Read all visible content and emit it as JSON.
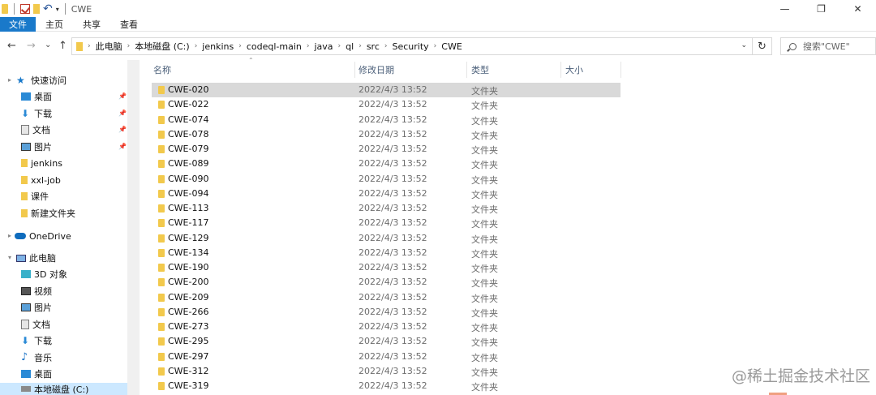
{
  "window": {
    "title": "CWE",
    "minimize": "—",
    "restore": "❐",
    "close": "✕"
  },
  "quick_access_toolbar": {
    "undo": "↶",
    "dropdown": "▾"
  },
  "ribbon": {
    "tabs": [
      {
        "label": "文件",
        "active": true
      },
      {
        "label": "主页"
      },
      {
        "label": "共享"
      },
      {
        "label": "查看"
      }
    ]
  },
  "nav": {
    "back": "←",
    "forward": "→",
    "recent": "⌄",
    "up": "↑"
  },
  "address": {
    "breadcrumbs": [
      "此电脑",
      "本地磁盘 (C:)",
      "jenkins",
      "codeql-main",
      "java",
      "ql",
      "src",
      "Security",
      "CWE"
    ],
    "separator": "›",
    "dropdown": "⌄",
    "refresh": "↻"
  },
  "search": {
    "placeholder": "搜索\"CWE\""
  },
  "sidebar": {
    "quick_access": "快速访问",
    "quick_items": [
      {
        "label": "桌面",
        "icon": "desktop-icon",
        "pinned": true
      },
      {
        "label": "下载",
        "icon": "download-icon",
        "pinned": true
      },
      {
        "label": "文档",
        "icon": "documents-icon",
        "pinned": true
      },
      {
        "label": "图片",
        "icon": "pictures-icon",
        "pinned": true
      },
      {
        "label": "jenkins",
        "icon": "folder-icon"
      },
      {
        "label": "xxl-job",
        "icon": "folder-icon"
      },
      {
        "label": "课件",
        "icon": "folder-icon"
      },
      {
        "label": "新建文件夹",
        "icon": "folder-icon"
      }
    ],
    "onedrive": "OneDrive",
    "this_pc": "此电脑",
    "pc_items": [
      {
        "label": "3D 对象",
        "icon": "3d-objects-icon"
      },
      {
        "label": "视频",
        "icon": "videos-icon"
      },
      {
        "label": "图片",
        "icon": "pictures-icon"
      },
      {
        "label": "文档",
        "icon": "documents-icon"
      },
      {
        "label": "下载",
        "icon": "download-icon"
      },
      {
        "label": "音乐",
        "icon": "music-icon"
      },
      {
        "label": "桌面",
        "icon": "desktop-icon"
      },
      {
        "label": "本地磁盘 (C:)",
        "icon": "drive-icon",
        "selected": true
      }
    ]
  },
  "columns": {
    "name": "名称",
    "date": "修改日期",
    "type": "类型",
    "size": "大小"
  },
  "files": [
    {
      "name": "CWE-020",
      "date": "2022/4/3 13:52",
      "type": "文件夹",
      "selected": true
    },
    {
      "name": "CWE-022",
      "date": "2022/4/3 13:52",
      "type": "文件夹"
    },
    {
      "name": "CWE-074",
      "date": "2022/4/3 13:52",
      "type": "文件夹"
    },
    {
      "name": "CWE-078",
      "date": "2022/4/3 13:52",
      "type": "文件夹"
    },
    {
      "name": "CWE-079",
      "date": "2022/4/3 13:52",
      "type": "文件夹"
    },
    {
      "name": "CWE-089",
      "date": "2022/4/3 13:52",
      "type": "文件夹"
    },
    {
      "name": "CWE-090",
      "date": "2022/4/3 13:52",
      "type": "文件夹"
    },
    {
      "name": "CWE-094",
      "date": "2022/4/3 13:52",
      "type": "文件夹"
    },
    {
      "name": "CWE-113",
      "date": "2022/4/3 13:52",
      "type": "文件夹"
    },
    {
      "name": "CWE-117",
      "date": "2022/4/3 13:52",
      "type": "文件夹"
    },
    {
      "name": "CWE-129",
      "date": "2022/4/3 13:52",
      "type": "文件夹"
    },
    {
      "name": "CWE-134",
      "date": "2022/4/3 13:52",
      "type": "文件夹"
    },
    {
      "name": "CWE-190",
      "date": "2022/4/3 13:52",
      "type": "文件夹"
    },
    {
      "name": "CWE-200",
      "date": "2022/4/3 13:52",
      "type": "文件夹"
    },
    {
      "name": "CWE-209",
      "date": "2022/4/3 13:52",
      "type": "文件夹"
    },
    {
      "name": "CWE-266",
      "date": "2022/4/3 13:52",
      "type": "文件夹"
    },
    {
      "name": "CWE-273",
      "date": "2022/4/3 13:52",
      "type": "文件夹"
    },
    {
      "name": "CWE-295",
      "date": "2022/4/3 13:52",
      "type": "文件夹"
    },
    {
      "name": "CWE-297",
      "date": "2022/4/3 13:52",
      "type": "文件夹"
    },
    {
      "name": "CWE-312",
      "date": "2022/4/3 13:52",
      "type": "文件夹"
    },
    {
      "name": "CWE-319",
      "date": "2022/4/3 13:52",
      "type": "文件夹"
    }
  ],
  "watermark": "@稀土掘金技术社区",
  "colors": {
    "accent": "#1979ca",
    "folder": "#f2c94c",
    "selection": "#cce8ff",
    "row_selected": "#d9d9d9"
  }
}
